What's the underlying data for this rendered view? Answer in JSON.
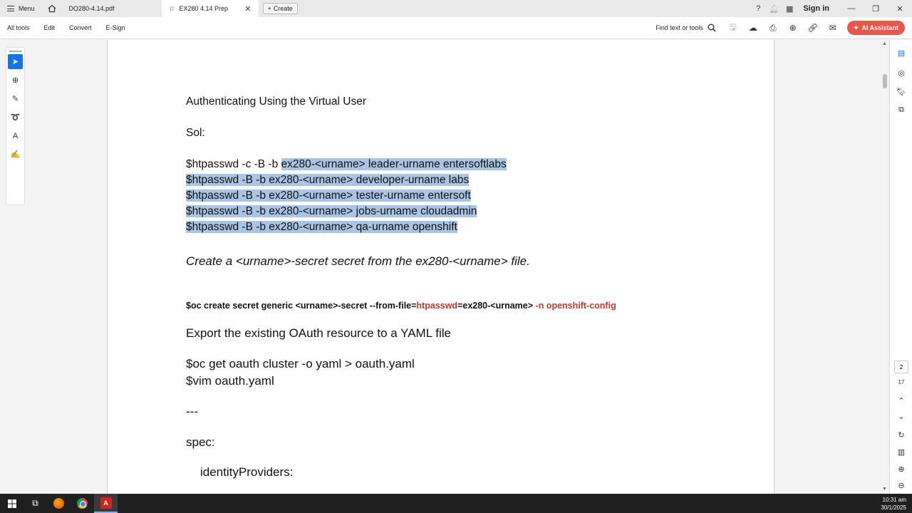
{
  "tabbar": {
    "menu_label": "Menu",
    "tabs": [
      {
        "label": "DO280-4.14.pdf"
      },
      {
        "label": "EX280 4.14 Prep"
      }
    ],
    "create_label": "Create",
    "sign_in": "Sign in"
  },
  "toolbar": {
    "items": [
      "All tools",
      "Edit",
      "Convert",
      "E-Sign"
    ],
    "find_label": "Find text or tools",
    "ai_label": "AI Assistant"
  },
  "document": {
    "heading1": "Authenticating Using the Virtual User",
    "sol": "Sol:",
    "cmd1_plain": "$htpasswd -c -B -b ",
    "cmd1_highlight": "ex280-<urname> leader-urname entersoftlabs",
    "cmd2": "$htpasswd -B -b ex280-<urname> developer-urname labs",
    "cmd3": "$htpasswd -B -b ex280-<urname> tester-urname entersoft",
    "cmd4": "$htpasswd -B -b ex280-<urname> jobs-urname cloudadmin",
    "cmd5": "$htpasswd -B -b ex280-<urname> qa-urname openshift",
    "task_create_secret": "Create a <urname>-secret secret from the ex280-<urname> file.",
    "secret_cmd_a": "$oc create secret generic <urname>-secret --from-file=",
    "secret_cmd_b": "htpasswd",
    "secret_cmd_c": "=ex280-<urname> ",
    "secret_cmd_d": "-n openshift-config",
    "export_heading": "Export the existing OAuth resource to a YAML file",
    "oc_get": "$oc get oauth cluster -o yaml > oauth.yaml",
    "vim": "$vim oauth.yaml",
    "dashes": "---",
    "spec": "spec:",
    "identity": "identityProviders:"
  },
  "page_nav": {
    "current": "2",
    "total": "17"
  },
  "taskbar": {
    "time": "10:31 am",
    "date": "30/1/2025"
  },
  "colors": {
    "accent": "#1473e6",
    "ai_button": "#e8574b",
    "highlight": "#a9c5e6",
    "red_text": "#c0392b"
  }
}
